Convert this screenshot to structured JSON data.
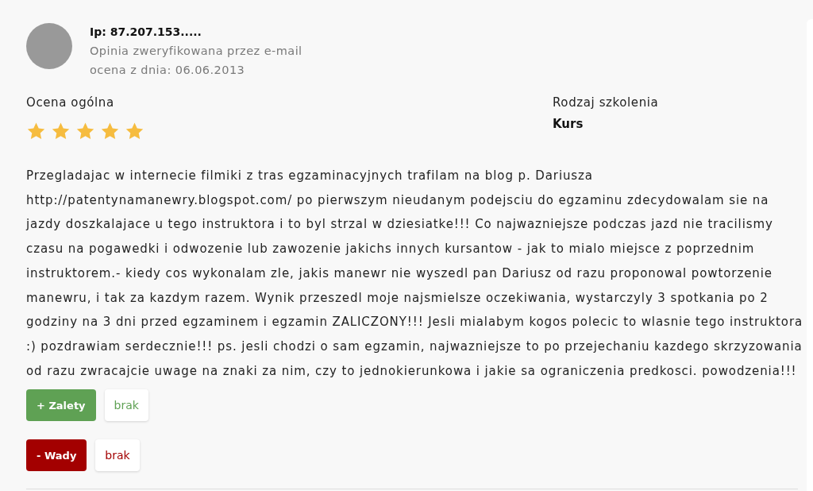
{
  "review": {
    "author": "Ip: 87.207.153.....",
    "verification": "Opinia zweryfikowana przez e-mail",
    "date": "ocena z dnia: 06.06.2013"
  },
  "ratings": {
    "overall": {
      "label": "Ocena ogólna",
      "stars": 5
    },
    "training_type": {
      "label": "Rodzaj szkolenia",
      "value": "Kurs"
    }
  },
  "body": "Przegladajac w internecie filmiki z tras egzaminacyjnych trafilam na blog p. Dariusza http://patentynamanewry.blogspot.com/ po pierwszym nieudanym podejsciu do egzaminu zdecydowalam sie na jazdy doszkalajace u tego instruktora i to byl strzal w dziesiatke!!! Co najwazniejsze podczas jazd nie tracilismy czasu na pogawedki i odwozenie lub zawozenie jakichs innych kursantow - jak to mialo miejsce z poprzednim instruktorem.- kiedy cos wykonalam zle, jakis manewr nie wyszedl pan Dariusz od razu proponowal powtorzenie manewru, i tak za kazdym razem. Wynik przeszedl moje najsmielsze oczekiwania, wystarczyly 3 spotkania po 2 godziny na 3 dni przed egzaminem i egzamin ZALICZONY!!! Jesli mialabym kogos polecic to wlasnie tego instruktora :) pozdrawiam serdecznie!!! ps. jesli chodzi o sam egzamin, najwazniejsze to po przejechaniu kazdego skrzyzowania od razu zwracajcie uwage na znaki za nim, czy to jednokierunkowa i jakie sa ograniczenia predkosci. powodzenia!!!",
  "pros_cons": [
    {
      "kind": "pros",
      "label": "+ Zalety",
      "value": "brak"
    },
    {
      "kind": "cons",
      "label": "- Wady",
      "value": "brak"
    }
  ]
}
